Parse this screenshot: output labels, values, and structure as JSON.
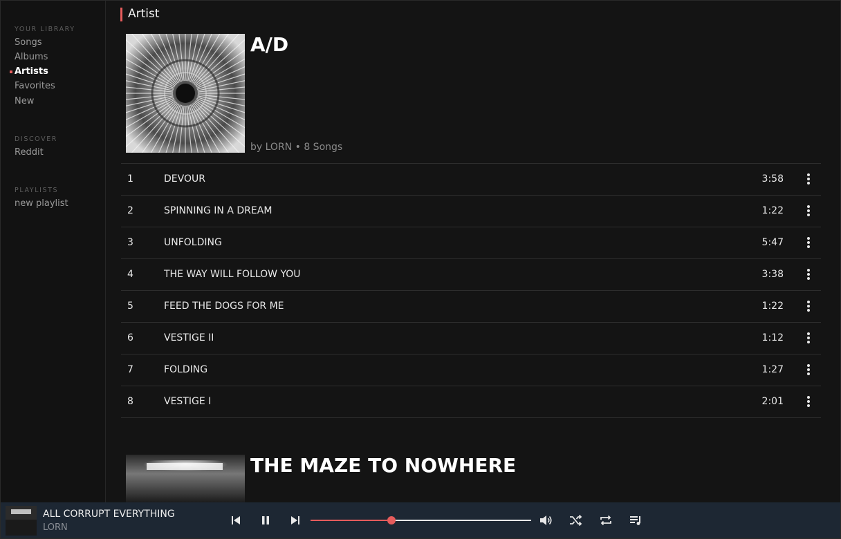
{
  "sidebar": {
    "library_title": "YOUR LIBRARY",
    "library_items": [
      "Songs",
      "Albums",
      "Artists",
      "Favorites",
      "New"
    ],
    "active_item": "Artists",
    "discover_title": "DISCOVER",
    "discover_items": [
      "Reddit"
    ],
    "playlists_title": "PLAYLISTS",
    "playlist_items": [
      "new playlist"
    ]
  },
  "page": {
    "heading": "Artist"
  },
  "albums": [
    {
      "title": "A/D",
      "by_label": "by LORN",
      "separator": "•",
      "count_label": "8 Songs",
      "tracks": [
        {
          "num": "1",
          "title": "DEVOUR",
          "duration": "3:58"
        },
        {
          "num": "2",
          "title": "SPINNING IN A DREAM",
          "duration": "1:22"
        },
        {
          "num": "3",
          "title": "UNFOLDING",
          "duration": "5:47"
        },
        {
          "num": "4",
          "title": "THE WAY WILL FOLLOW YOU",
          "duration": "3:38"
        },
        {
          "num": "5",
          "title": "FEED THE DOGS FOR ME",
          "duration": "1:22"
        },
        {
          "num": "6",
          "title": "VESTIGE II",
          "duration": "1:12"
        },
        {
          "num": "7",
          "title": "FOLDING",
          "duration": "1:27"
        },
        {
          "num": "8",
          "title": "VESTIGE I",
          "duration": "2:01"
        }
      ]
    },
    {
      "title": "THE MAZE TO NOWHERE"
    }
  ],
  "player": {
    "title": "ALL CORRUPT EVERYTHING",
    "artist": "LORN",
    "progress": 0.367,
    "icons": [
      "skip-previous-icon",
      "pause-icon",
      "skip-next-icon",
      "volume-icon",
      "shuffle-icon",
      "repeat-icon",
      "queue-icon"
    ]
  },
  "colors": {
    "accent": "#e65c5c",
    "background": "#141414",
    "player_bar": "#1d2733"
  }
}
